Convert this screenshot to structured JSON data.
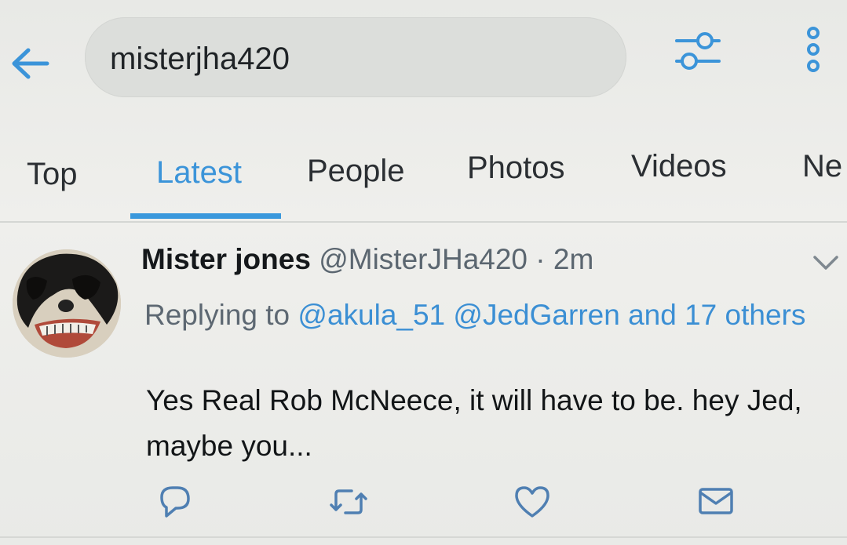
{
  "search": {
    "query": "misterjha420"
  },
  "header": {
    "back_icon": "arrow-left-icon",
    "filter_icon": "sliders-icon",
    "more_icon": "more-vertical-icon"
  },
  "tabs": [
    {
      "label": "Top"
    },
    {
      "label": "Latest",
      "active": true
    },
    {
      "label": "People"
    },
    {
      "label": "Photos"
    },
    {
      "label": "Videos"
    },
    {
      "label": "Ne"
    }
  ],
  "tweet": {
    "display_name": "Mister jones",
    "handle": "@MisterJHa420",
    "separator": "·",
    "time": "2m",
    "replying_prefix": "Replying to",
    "mention_1": "@akula_51",
    "mention_2": "@JedGarren",
    "and_more": "and 17 others",
    "text": "Yes Real Rob McNeece, it will have to be. hey Jed, maybe you..."
  },
  "actions": {
    "reply_icon": "reply-icon",
    "retweet_icon": "retweet-icon",
    "like_icon": "heart-icon",
    "dm_icon": "mail-icon"
  },
  "colors": {
    "accent": "#3b94d9",
    "background": "#ececea",
    "text": "#1a1d20",
    "muted": "#5b6670"
  }
}
